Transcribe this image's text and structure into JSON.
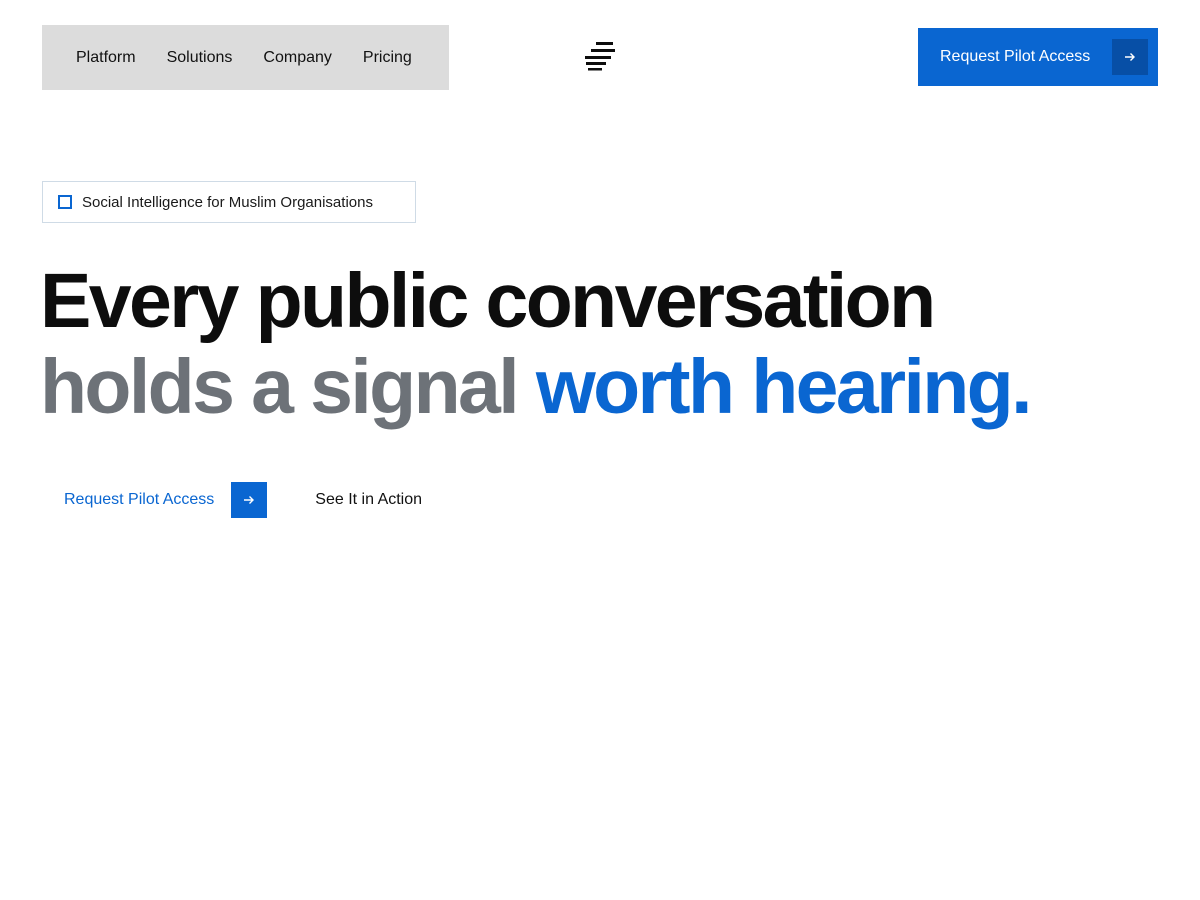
{
  "header": {
    "nav": [
      {
        "label": "Platform"
      },
      {
        "label": "Solutions"
      },
      {
        "label": "Company"
      },
      {
        "label": "Pricing"
      }
    ],
    "logo_icon": "stacked-lines-logo-icon",
    "cta_label": "Request Pilot Access",
    "cta_icon": "arrow-right-icon"
  },
  "hero": {
    "badge": {
      "icon": "square-outline-icon",
      "text": "Social Intelligence for Muslim Organisations"
    },
    "headline": {
      "line1": "Every public conversation",
      "line2_plain": "holds a signal ",
      "line2_accent": "worth hearing."
    },
    "primary_cta": {
      "label": "Request Pilot Access",
      "icon": "arrow-right-icon"
    },
    "secondary_cta": {
      "label": "See It in Action"
    }
  },
  "colors": {
    "accent": "#0a66d1",
    "accent_dark": "#074fa6",
    "nav_background": "#dcdcdc",
    "headline_dark": "#0d0d0d",
    "headline_muted": "#6d7278"
  }
}
